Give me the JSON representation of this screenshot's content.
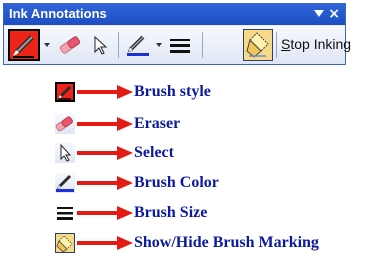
{
  "toolbar": {
    "title": "Ink Annotations",
    "close_glyph": "×",
    "stop_inking_hotkey": "S",
    "stop_inking_rest": "top Inking",
    "colors": {
      "titlebar": "#1d4fc3",
      "brush_swatch": "#ef2418",
      "brush_color_line": "#1f2fd8",
      "toggle_active": "#f7d98a"
    }
  },
  "legend": [
    {
      "icon": "brush-style-icon",
      "label": "Brush style"
    },
    {
      "icon": "eraser-icon",
      "label": "Eraser"
    },
    {
      "icon": "select-icon",
      "label": "Select"
    },
    {
      "icon": "brush-color-icon",
      "label": "Brush Color"
    },
    {
      "icon": "brush-size-icon",
      "label": "Brush Size"
    },
    {
      "icon": "show-hide-brush-marking-icon",
      "label": "Show/Hide Brush Marking"
    }
  ],
  "arrow_color": "#e31b12"
}
